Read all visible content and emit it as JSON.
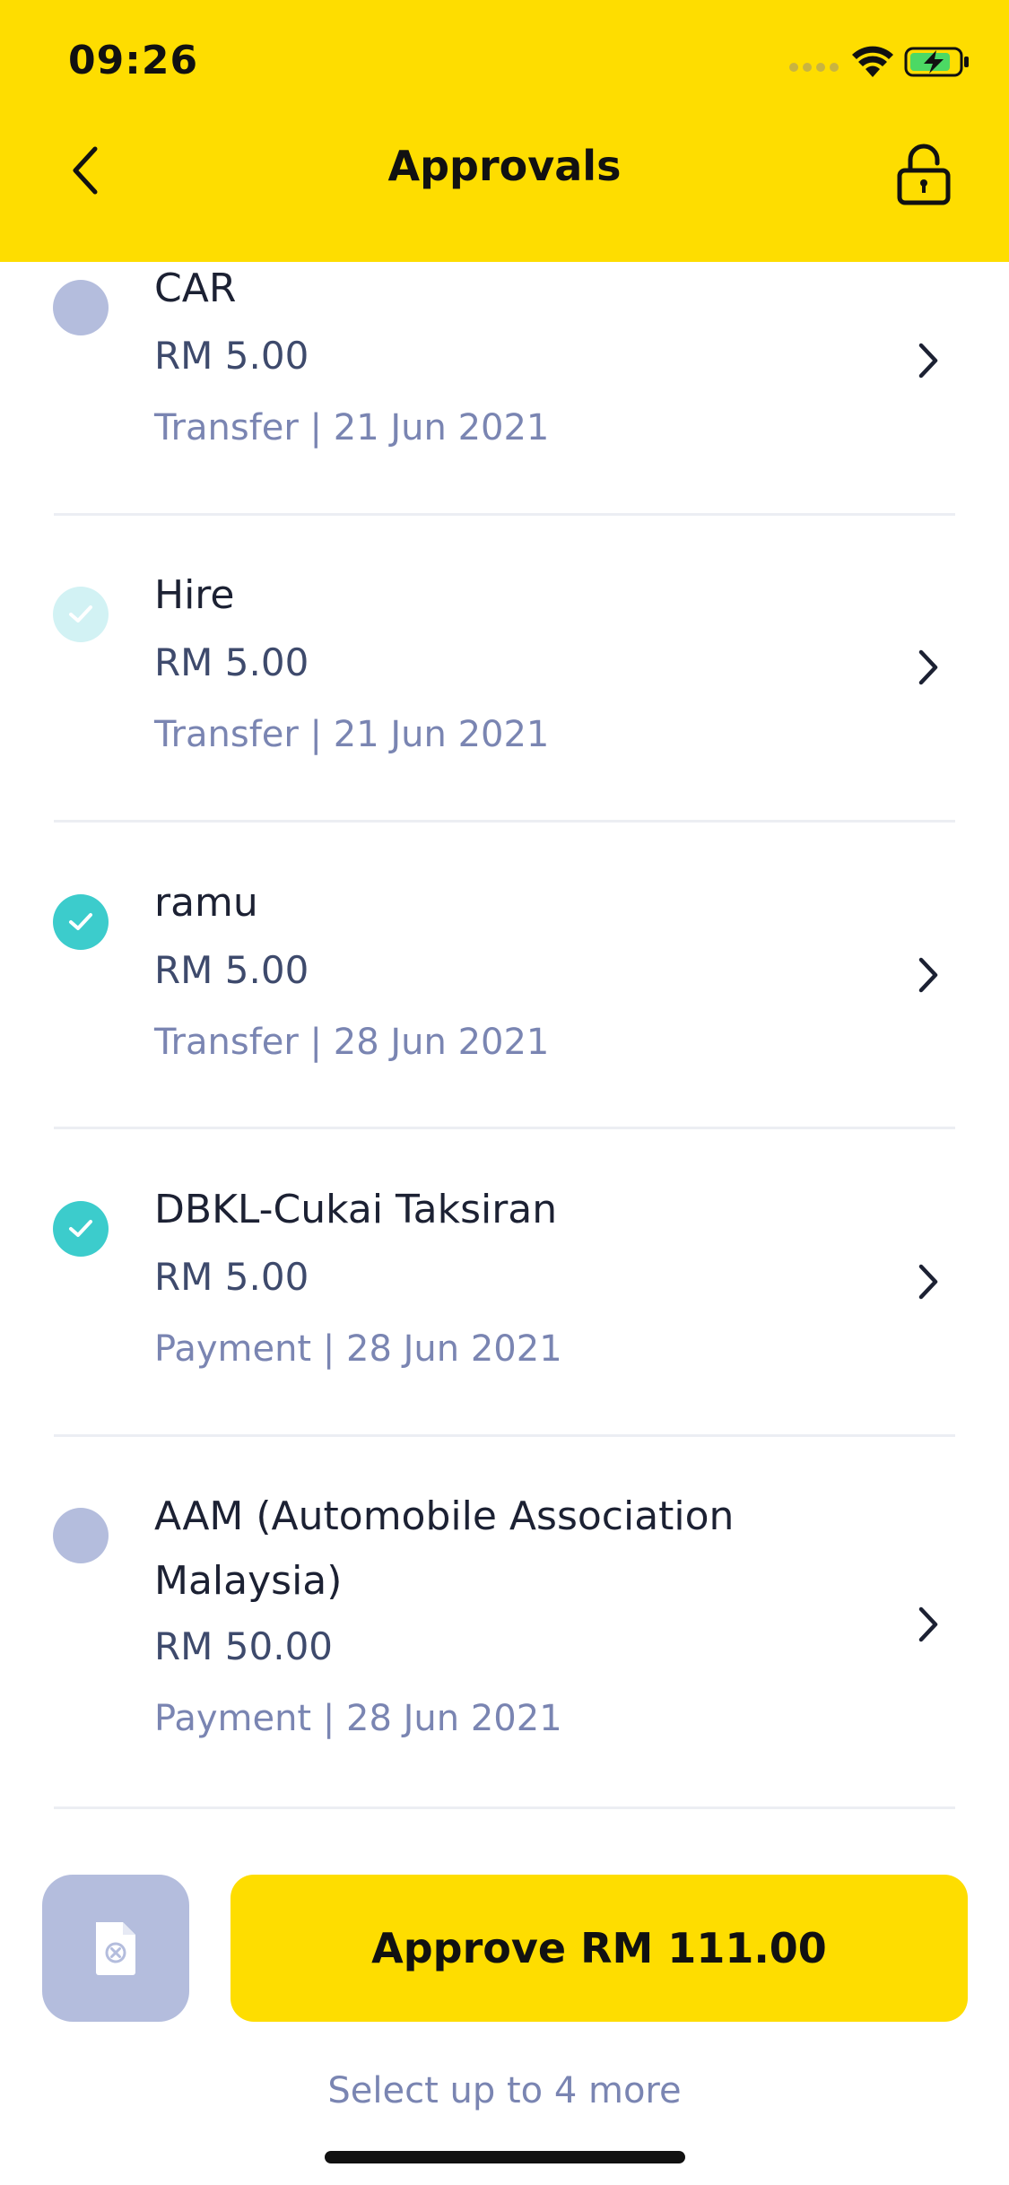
{
  "status_bar": {
    "time": "09:26"
  },
  "header": {
    "title": "Approvals",
    "back_icon": "chevron-left-icon",
    "lock_icon": "unlock-icon"
  },
  "items": [
    {
      "name": "CAR",
      "amount": "RM 5.00",
      "meta": "Transfer | 21 Jun 2021",
      "state": "unselected"
    },
    {
      "name": "Hire",
      "amount": "RM 5.00",
      "meta": "Transfer | 21 Jun 2021",
      "state": "disabled"
    },
    {
      "name": "ramu",
      "amount": "RM 5.00",
      "meta": "Transfer | 28 Jun 2021",
      "state": "checked"
    },
    {
      "name": "DBKL-Cukai Taksiran",
      "amount": "RM 5.00",
      "meta": "Payment | 28 Jun 2021",
      "state": "checked"
    },
    {
      "name": "AAM (Automobile Association Malaysia)",
      "amount": "RM 50.00",
      "meta": "Payment | 28 Jun 2021",
      "state": "unselected"
    }
  ],
  "footer": {
    "approve_label": "Approve RM 111.00",
    "hint": "Select up to 4 more"
  },
  "colors": {
    "brand_yellow": "#fedd00",
    "check_teal": "#3ccccc",
    "radio_unselected": "#b4bddd",
    "radio_disabled": "#d2f2f4"
  }
}
